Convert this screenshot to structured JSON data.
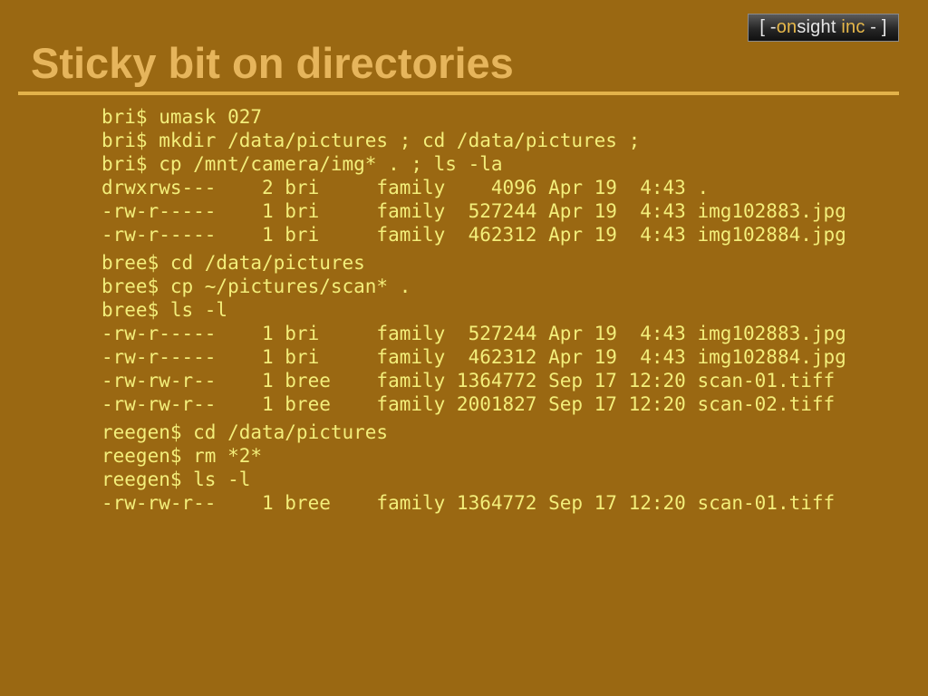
{
  "logo": {
    "bracket_left": "[ -",
    "on": "on",
    "sight": "sight",
    "inc": "inc",
    "bracket_right": "- ]"
  },
  "slide": {
    "title": "Sticky bit on directories"
  },
  "terminal": {
    "blocks": [
      [
        "bri$ umask 027",
        "bri$ mkdir /data/pictures ; cd /data/pictures ;",
        "bri$ cp /mnt/camera/img* . ; ls -la",
        "drwxrws---    2 bri     family    4096 Apr 19  4:43 .",
        "-rw-r-----    1 bri     family  527244 Apr 19  4:43 img102883.jpg",
        "-rw-r-----    1 bri     family  462312 Apr 19  4:43 img102884.jpg"
      ],
      [
        "bree$ cd /data/pictures",
        "bree$ cp ~/pictures/scan* .",
        "bree$ ls -l",
        "-rw-r-----    1 bri     family  527244 Apr 19  4:43 img102883.jpg",
        "-rw-r-----    1 bri     family  462312 Apr 19  4:43 img102884.jpg",
        "-rw-rw-r--    1 bree    family 1364772 Sep 17 12:20 scan-01.tiff",
        "-rw-rw-r--    1 bree    family 2001827 Sep 17 12:20 scan-02.tiff"
      ],
      [
        "reegen$ cd /data/pictures",
        "reegen$ rm *2*",
        "reegen$ ls -l",
        "-rw-rw-r--    1 bree    family 1364772 Sep 17 12:20 scan-01.tiff"
      ]
    ]
  }
}
